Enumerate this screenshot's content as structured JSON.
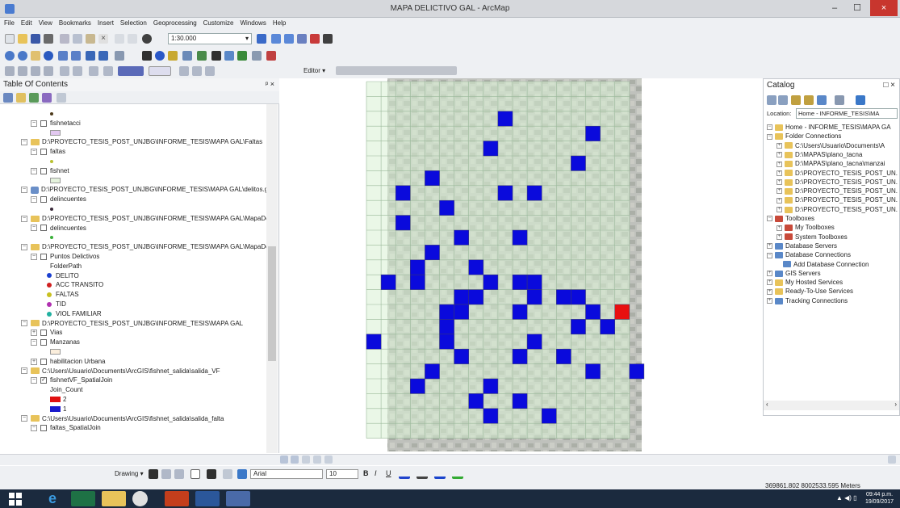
{
  "window": {
    "title": "MAPA DELICTIVO GAL - ArcMap",
    "min_glyph": "–",
    "max_glyph": "☐",
    "close_glyph": "×"
  },
  "menu": [
    "File",
    "Edit",
    "View",
    "Bookmarks",
    "Insert",
    "Selection",
    "Geoprocessing",
    "Customize",
    "Windows",
    "Help"
  ],
  "toolbar": {
    "scale": "1:30.000",
    "editor_label": "Editor ▾"
  },
  "toc": {
    "title": "Table Of Contents",
    "pin": "ᵖ ×",
    "rows": [
      {
        "indent": 62,
        "kind": "sym",
        "color": "#4d3a1a",
        "shape": "dot"
      },
      {
        "indent": 38,
        "kind": "layer",
        "label": "fishnetacci",
        "exp": "−",
        "checked": false
      },
      {
        "indent": 62,
        "kind": "sym",
        "color": "#e2c8f0",
        "shape": "rect"
      },
      {
        "indent": 26,
        "kind": "folder",
        "label": "D:\\PROYECTO_TESIS_POST_UNJBG\\INFORME_TESIS\\MAPA GAL\\Faltas",
        "exp": "−"
      },
      {
        "indent": 38,
        "kind": "layer",
        "label": "faltas",
        "exp": "−",
        "checked": false
      },
      {
        "indent": 62,
        "kind": "sym",
        "color": "#b8c030",
        "shape": "dot"
      },
      {
        "indent": 38,
        "kind": "layer",
        "label": "fishnet",
        "exp": "−",
        "checked": false
      },
      {
        "indent": 62,
        "kind": "sym",
        "color": "#e4f2dc",
        "shape": "rect"
      },
      {
        "indent": 26,
        "kind": "gdb",
        "label": "D:\\PROYECTO_TESIS_POST_UNJBG\\INFORME_TESIS\\MAPA GAL\\delitos.gdb",
        "exp": "−"
      },
      {
        "indent": 38,
        "kind": "layer",
        "label": "delincuentes",
        "exp": "−",
        "checked": false
      },
      {
        "indent": 62,
        "kind": "sym",
        "color": "#3a2a3a",
        "shape": "dot"
      },
      {
        "indent": 26,
        "kind": "folder",
        "label": "D:\\PROYECTO_TESIS_POST_UNJBG\\INFORME_TESIS\\MAPA GAL\\MapaDelitc",
        "exp": "−"
      },
      {
        "indent": 38,
        "kind": "layer",
        "label": "delincuentes",
        "exp": "−",
        "checked": false
      },
      {
        "indent": 62,
        "kind": "sym",
        "color": "#3ab03a",
        "shape": "dot"
      },
      {
        "indent": 26,
        "kind": "folder",
        "label": "D:\\PROYECTO_TESIS_POST_UNJBG\\INFORME_TESIS\\MAPA GAL\\MapaDelitc",
        "exp": "−"
      },
      {
        "indent": 38,
        "kind": "layer",
        "label": "Puntos Delictivos",
        "exp": "−",
        "checked": false
      },
      {
        "indent": 62,
        "kind": "text",
        "label": "FolderPath"
      },
      {
        "indent": 58,
        "kind": "legend",
        "label": "DELITO",
        "color": "#1a3fd0"
      },
      {
        "indent": 58,
        "kind": "legend",
        "label": "ACC TRANSITO",
        "color": "#d02020"
      },
      {
        "indent": 58,
        "kind": "legend",
        "label": "FALTAS",
        "color": "#c8c020"
      },
      {
        "indent": 58,
        "kind": "legend",
        "label": "TID",
        "color": "#b030b0"
      },
      {
        "indent": 58,
        "kind": "legend",
        "label": "VIOL FAMILIAR",
        "color": "#20b0a0"
      },
      {
        "indent": 26,
        "kind": "folder",
        "label": "D:\\PROYECTO_TESIS_POST_UNJBG\\INFORME_TESIS\\MAPA GAL",
        "exp": "−"
      },
      {
        "indent": 38,
        "kind": "layer",
        "label": "Vias",
        "exp": "+",
        "checked": false
      },
      {
        "indent": 38,
        "kind": "layer",
        "label": "Manzanas",
        "exp": "−",
        "checked": false
      },
      {
        "indent": 62,
        "kind": "sym",
        "color": "#fbeedc",
        "shape": "rect"
      },
      {
        "indent": 38,
        "kind": "layer",
        "label": "habilitacion Urbana",
        "exp": "+",
        "checked": false
      },
      {
        "indent": 26,
        "kind": "folder",
        "label": "C:\\Users\\Usuario\\Documents\\ArcGIS\\fishnet_salida\\salida_VF",
        "exp": "−"
      },
      {
        "indent": 38,
        "kind": "layer",
        "label": "fishnetVF_SpatialJoin",
        "exp": "−",
        "checked": true
      },
      {
        "indent": 62,
        "kind": "text",
        "label": "Join_Count"
      },
      {
        "indent": 62,
        "kind": "legend-rect",
        "label": "2",
        "color": "#e01010"
      },
      {
        "indent": 62,
        "kind": "legend-rect",
        "label": "1",
        "color": "#1a1acc"
      },
      {
        "indent": 26,
        "kind": "folder",
        "label": "C:\\Users\\Usuario\\Documents\\ArcGIS\\fishnet_salida\\salida_falta",
        "exp": "−"
      },
      {
        "indent": 38,
        "kind": "layer",
        "label": "faltas_SpatialJoin",
        "exp": "−",
        "checked": false
      }
    ]
  },
  "map": {
    "grid_cols": 18,
    "grid_rows": 24,
    "blue_color": "#0a0adc",
    "red_color": "#e81010",
    "grid_fill": "#d8f0d4",
    "blue_cells": [
      [
        9,
        2
      ],
      [
        15,
        3
      ],
      [
        8,
        4
      ],
      [
        14,
        5
      ],
      [
        4,
        6
      ],
      [
        2,
        7
      ],
      [
        5,
        8
      ],
      [
        9,
        7
      ],
      [
        11,
        7
      ],
      [
        2,
        9
      ],
      [
        6,
        10
      ],
      [
        10,
        10
      ],
      [
        3,
        12
      ],
      [
        4,
        11
      ],
      [
        1,
        13
      ],
      [
        3,
        13
      ],
      [
        7,
        12
      ],
      [
        8,
        13
      ],
      [
        10,
        13
      ],
      [
        11,
        13
      ],
      [
        6,
        14
      ],
      [
        7,
        14
      ],
      [
        11,
        14
      ],
      [
        13,
        14
      ],
      [
        14,
        14
      ],
      [
        5,
        15
      ],
      [
        6,
        15
      ],
      [
        10,
        15
      ],
      [
        15,
        15
      ],
      [
        0,
        17
      ],
      [
        5,
        16
      ],
      [
        14,
        16
      ],
      [
        16,
        16
      ],
      [
        11,
        17
      ],
      [
        5,
        17
      ],
      [
        6,
        18
      ],
      [
        10,
        18
      ],
      [
        13,
        18
      ],
      [
        4,
        19
      ],
      [
        15,
        19
      ],
      [
        18,
        19
      ],
      [
        3,
        20
      ],
      [
        8,
        20
      ],
      [
        7,
        21
      ],
      [
        10,
        21
      ],
      [
        8,
        22
      ],
      [
        12,
        22
      ]
    ],
    "red_cells": [
      [
        17,
        15
      ]
    ]
  },
  "catalog": {
    "title": "Catalog",
    "location_label": "Location:",
    "location_value": "Home - INFORME_TESIS\\MA",
    "items": [
      {
        "indent": 4,
        "exp": "−",
        "icon": "folder",
        "label": "Home - INFORME_TESIS\\MAPA GA"
      },
      {
        "indent": 4,
        "exp": "−",
        "icon": "folder",
        "label": "Folder Connections"
      },
      {
        "indent": 16,
        "exp": "+",
        "icon": "folder",
        "label": "C:\\Users\\Usuario\\Documents\\A"
      },
      {
        "indent": 16,
        "exp": "+",
        "icon": "folder",
        "label": "D:\\MAPAS\\plano_tacna"
      },
      {
        "indent": 16,
        "exp": "+",
        "icon": "folder",
        "label": "D:\\MAPAS\\plano_tacna\\manzai"
      },
      {
        "indent": 16,
        "exp": "+",
        "icon": "folder",
        "label": "D:\\PROYECTO_TESIS_POST_UN."
      },
      {
        "indent": 16,
        "exp": "+",
        "icon": "folder",
        "label": "D:\\PROYECTO_TESIS_POST_UN."
      },
      {
        "indent": 16,
        "exp": "+",
        "icon": "folder",
        "label": "D:\\PROYECTO_TESIS_POST_UN."
      },
      {
        "indent": 16,
        "exp": "+",
        "icon": "folder",
        "label": "D:\\PROYECTO_TESIS_POST_UN."
      },
      {
        "indent": 16,
        "exp": "+",
        "icon": "folder",
        "label": "D:\\PROYECTO_TESIS_POST_UN."
      },
      {
        "indent": 4,
        "exp": "−",
        "icon": "toolbox",
        "label": "Toolboxes"
      },
      {
        "indent": 16,
        "exp": "+",
        "icon": "toolbox",
        "label": "My Toolboxes"
      },
      {
        "indent": 16,
        "exp": "+",
        "icon": "toolbox",
        "label": "System Toolboxes"
      },
      {
        "indent": 4,
        "exp": "+",
        "icon": "db",
        "label": "Database Servers"
      },
      {
        "indent": 4,
        "exp": "−",
        "icon": "db",
        "label": "Database Connections"
      },
      {
        "indent": 24,
        "exp": "",
        "icon": "db",
        "label": "Add Database Connection"
      },
      {
        "indent": 4,
        "exp": "+",
        "icon": "db",
        "label": "GIS Servers"
      },
      {
        "indent": 4,
        "exp": "+",
        "icon": "folder",
        "label": "My Hosted Services"
      },
      {
        "indent": 4,
        "exp": "+",
        "icon": "folder",
        "label": "Ready-To-Use Services"
      },
      {
        "indent": 4,
        "exp": "+",
        "icon": "db",
        "label": "Tracking Connections"
      }
    ]
  },
  "drawing": {
    "label": "Drawing ▾",
    "font": "Arial",
    "size": "10"
  },
  "status": {
    "coords": "369861.802  8002533.595 Meters"
  },
  "taskbar": {
    "time": "09:44 p.m.",
    "date": "19/09/2017"
  }
}
